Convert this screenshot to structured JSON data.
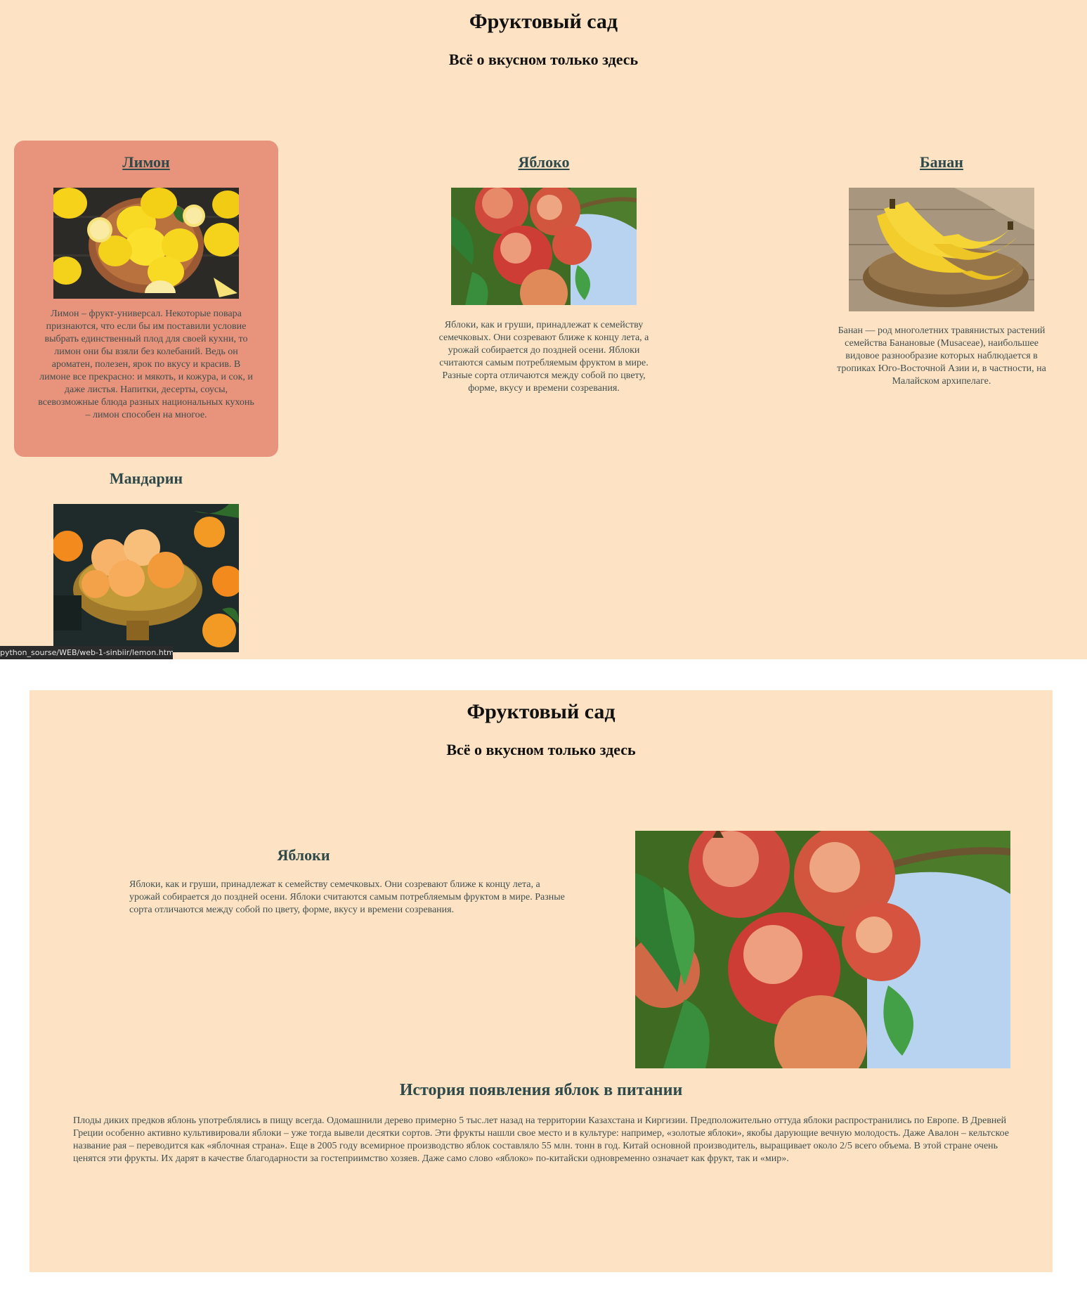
{
  "colors": {
    "page_bg": "#fde3c4",
    "card_active_bg": "#e8937b",
    "heading": "#2f4a4a",
    "text": "#3f4f4f"
  },
  "top": {
    "title": "Фруктовый сад",
    "subtitle": "Всё о вкусном только здесь",
    "cards": [
      {
        "title": "Лимон",
        "image_icon": "lemons-image",
        "text": "Лимон – фрукт-универсал. Некоторые повара признаются, что если бы им поставили условие выбрать единственный плод для своей кухни, то лимон они бы взяли без колебаний. Ведь он ароматен, полезен, ярок по вкусу и красив. В лимоне все прекрасно: и мякоть, и кожура, и сок, и даже листья. Напитки, десерты, соусы, всевозможные блюда разных национальных кухонь – лимон способен на многое."
      },
      {
        "title": "Яблоко",
        "image_icon": "apples-image",
        "text": "Яблоки, как и груши, принадлежат к семейству семечковых. Они созревают ближе к концу лета, а урожай собирается до поздней осени. Яблоки считаются самым потребляемым фруктом в мире. Разные сорта отличаются между собой по цвету, форме, вкусу и времени созревания."
      },
      {
        "title": "Банан",
        "image_icon": "bananas-image",
        "text": "Банан — род многолетних травянистых растений семейства Банановые (Musaceae), наибольшее видовое разнообразие которых наблюдается в тропиках Юго-Восточной Азии и, в частности, на Малайском архипелаге."
      }
    ],
    "mandarin": {
      "title": "Мандарин",
      "image_icon": "mandarins-image"
    },
    "status_url": "python_sourse/WEB/web-1-sinbiir/lemon.html"
  },
  "bottom": {
    "title": "Фруктовый сад",
    "subtitle": "Всё о вкусном только здесь",
    "apple_heading": "Яблоки",
    "apple_text": "Яблоки, как и груши, принадлежат к семейству семечковых. Они созревают ближе к концу лета, а урожай собирается до поздней осени. Яблоки считаются самым потребляемым фруктом в мире. Разные сорта отличаются между собой по цвету, форме, вкусу и времени созревания.",
    "history_heading": "История появления яблок в питании",
    "history_text": "Плоды диких предков яблонь употреблялись в пищу всегда. Одомашнили дерево примерно 5 тыс.лет назад на территории Казахстана и Киргизии. Предположительно оттуда яблоки распространились по Европе. В Древней Греции особенно активно культивировали яблоки – уже тогда вывели десятки сортов. Эти фрукты нашли свое место и в культуре: например, «золотые яблоки», якобы дарующие вечную молодость. Даже Авалон – кельтское название рая – переводится как «яблочная страна». Еще в 2005 году всемирное производство яблок составляло 55 млн. тонн в год. Китай основной производитель, выращивает около 2/5 всего объема. В этой стране очень ценятся эти фрукты. Их дарят в качестве благодарности за гостеприимство хозяев. Даже само слово «яблоко» по-китайски одновременно означает как фрукт, так и «мир»."
  }
}
